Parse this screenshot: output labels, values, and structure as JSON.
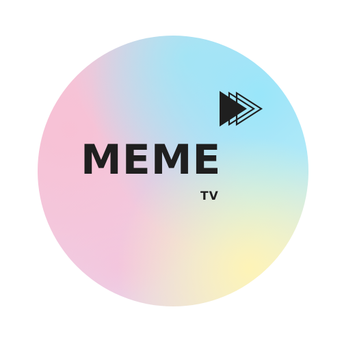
{
  "logo": {
    "title": "MEME",
    "subtitle": "TV",
    "icon": "fast-forward-icon",
    "text_color": "#1f1f1f",
    "gradient_colors": [
      "#f5c6d8",
      "#96e6fa",
      "#fff4b4",
      "#e8dcef"
    ]
  }
}
